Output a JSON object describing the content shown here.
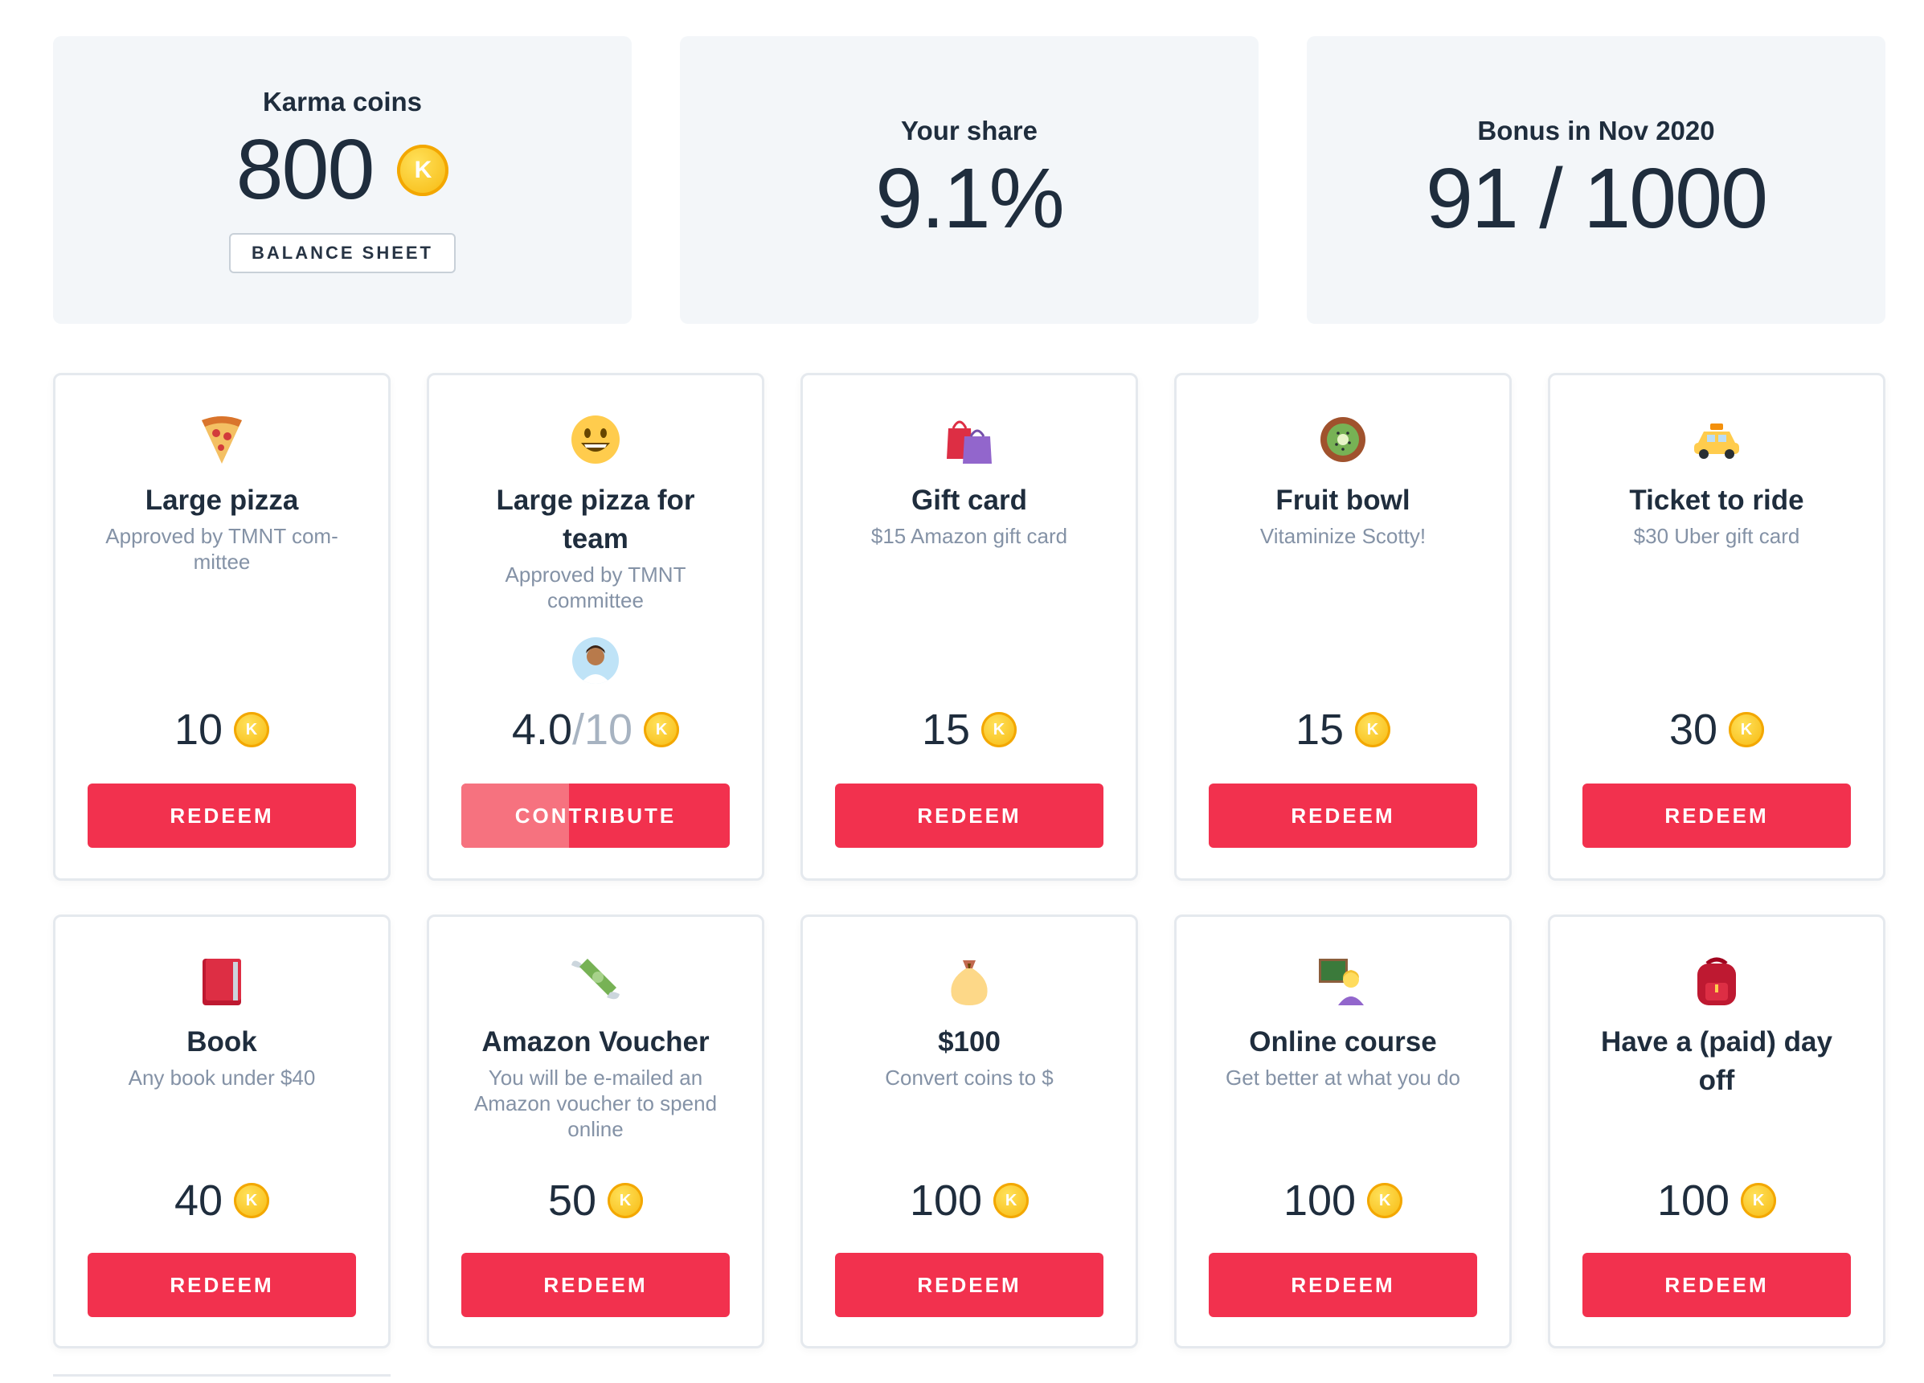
{
  "stats": {
    "karma": {
      "label": "Karma coins",
      "value": "800",
      "coin_glyph": "K",
      "button": "BALANCE SHEET"
    },
    "share": {
      "label": "Your share",
      "value": "9.1%"
    },
    "bonus": {
      "label": "Bonus in Nov 2020",
      "value": "91 / 1000"
    }
  },
  "rewards": [
    {
      "icon": "pizza-icon",
      "title": "Large pizza",
      "subtitle": "Approved by TMNT com-mittee",
      "price": "10",
      "button": "REDEEM"
    },
    {
      "icon": "grinning-face-icon",
      "title": "Large pizza for team",
      "subtitle": "Approved by TMNT committee",
      "price_current": "4.0",
      "price_total": "/10",
      "button": "CONTRIBUTE",
      "progress": 0.4
    },
    {
      "icon": "shopping-bags-icon",
      "title": "Gift card",
      "subtitle": "$15 Amazon gift card",
      "price": "15",
      "button": "REDEEM"
    },
    {
      "icon": "kiwi-icon",
      "title": "Fruit bowl",
      "subtitle": "Vitaminize Scotty!",
      "price": "15",
      "button": "REDEEM"
    },
    {
      "icon": "taxi-icon",
      "title": "Ticket to ride",
      "subtitle": "$30 Uber gift card",
      "price": "30",
      "button": "REDEEM"
    },
    {
      "icon": "book-icon",
      "title": "Book",
      "subtitle": "Any book under $40",
      "price": "40",
      "button": "REDEEM"
    },
    {
      "icon": "money-with-wings-icon",
      "title": "Amazon Voucher",
      "subtitle": "You will be e-mailed an Amazon voucher to spend online",
      "price": "50",
      "button": "REDEEM"
    },
    {
      "icon": "money-bag-icon",
      "title": "$100",
      "subtitle": "Convert coins to $",
      "price": "100",
      "button": "REDEEM"
    },
    {
      "icon": "teacher-icon",
      "title": "Online course",
      "subtitle": "Get better at what you do",
      "price": "100",
      "button": "REDEEM"
    },
    {
      "icon": "backpack-icon",
      "title": "Have a (paid) day off",
      "subtitle": "",
      "price": "100",
      "button": "REDEEM"
    }
  ],
  "colors": {
    "accent": "#f2314e",
    "accent_light": "#f6727f",
    "panel": "#f3f6f9",
    "coin": "#f6b60a"
  }
}
